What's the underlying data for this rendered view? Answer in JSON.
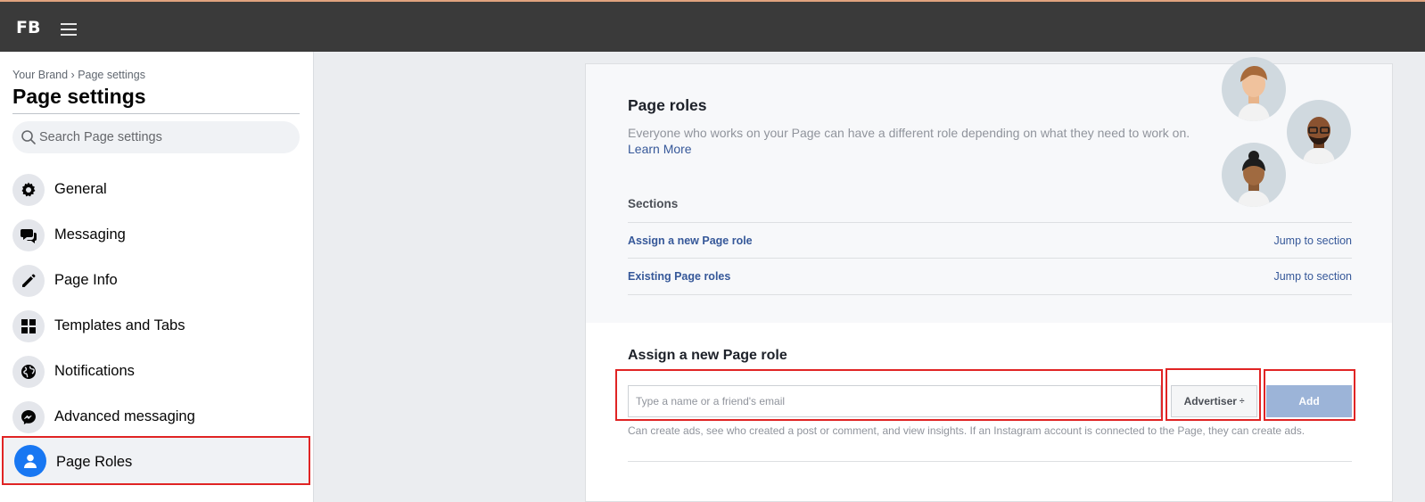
{
  "topbar": {
    "logo": "FB"
  },
  "sidebar": {
    "breadcrumb": "Your Brand › Page settings",
    "title": "Page settings",
    "search_placeholder": "Search Page settings",
    "items": [
      {
        "label": "General",
        "icon": "gear-icon"
      },
      {
        "label": "Messaging",
        "icon": "chat-bubbles-icon"
      },
      {
        "label": "Page Info",
        "icon": "pencil-icon"
      },
      {
        "label": "Templates and Tabs",
        "icon": "grid-icon"
      },
      {
        "label": "Notifications",
        "icon": "globe-icon"
      },
      {
        "label": "Advanced messaging",
        "icon": "messenger-icon"
      },
      {
        "label": "Page Roles",
        "icon": "person-icon",
        "active": true
      }
    ]
  },
  "main": {
    "roles_title": "Page roles",
    "roles_desc": "Everyone who works on your Page can have a different role depending on what they need to work on.",
    "learn_more": "Learn More",
    "sections_title": "Sections",
    "sections": [
      {
        "label": "Assign a new Page role",
        "jump": "Jump to section"
      },
      {
        "label": "Existing Page roles",
        "jump": "Jump to section"
      }
    ],
    "assign_title": "Assign a new Page role",
    "name_placeholder": "Type a name or a friend's email",
    "role_selected": "Advertiser",
    "role_arrow": "÷",
    "add_label": "Add",
    "role_help": "Can create ads, see who created a post or comment, and view insights. If an Instagram account is connected to the Page, they can create ads."
  },
  "colors": {
    "accent": "#1877f2",
    "link": "#365899",
    "highlight": "#e02424",
    "add_button": "#9cb4d8"
  }
}
